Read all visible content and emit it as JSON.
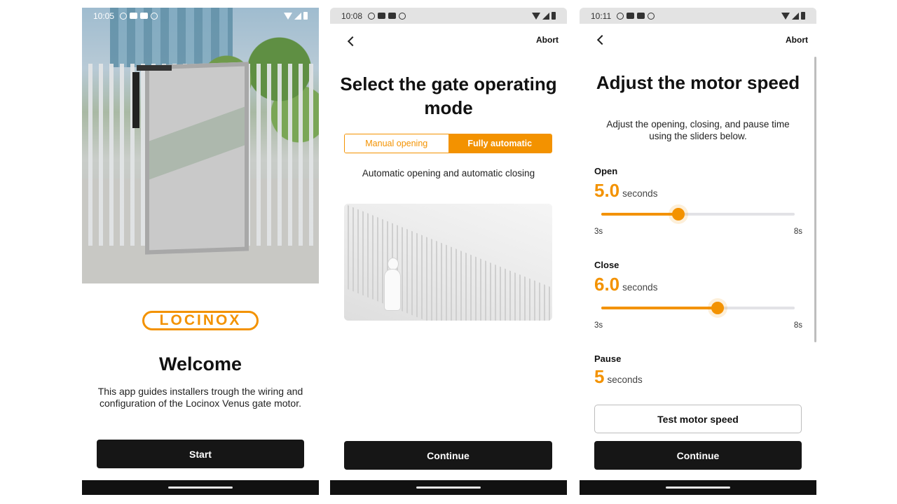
{
  "screen1": {
    "status": {
      "time": "10:05"
    },
    "logo_text": "LOCINOX",
    "title": "Welcome",
    "description": "This app guides installers trough the wiring and configuration of the Locinox Venus gate motor.",
    "start_label": "Start"
  },
  "screen2": {
    "status": {
      "time": "10:08"
    },
    "abort_label": "Abort",
    "title": "Select the gate operating mode",
    "segments": [
      {
        "label": "Manual opening",
        "selected": false
      },
      {
        "label": "Fully automatic",
        "selected": true
      }
    ],
    "mode_description": "Automatic opening and automatic closing",
    "continue_label": "Continue"
  },
  "screen3": {
    "status": {
      "time": "10:11"
    },
    "abort_label": "Abort",
    "title": "Adjust the motor speed",
    "description": "Adjust the opening, closing, and pause time using the sliders below.",
    "open": {
      "label": "Open",
      "value": "5.0",
      "unit": "seconds",
      "min_label": "3s",
      "max_label": "8s",
      "fraction": 0.4
    },
    "close": {
      "label": "Close",
      "value": "6.0",
      "unit": "seconds",
      "min_label": "3s",
      "max_label": "8s",
      "fraction": 0.6
    },
    "pause": {
      "label": "Pause",
      "value": "5",
      "unit": "seconds"
    },
    "test_label": "Test motor speed",
    "continue_label": "Continue"
  },
  "colors": {
    "accent": "#f39200",
    "button_dark": "#161616",
    "track": "#e2e2e6"
  },
  "icons": {
    "status": [
      "clock-icon",
      "youtube-icon",
      "youtube-icon",
      "app-icon",
      "wifi-icon",
      "signal-icon",
      "battery-icon"
    ],
    "navigation": [
      "back-chevron-icon"
    ]
  }
}
